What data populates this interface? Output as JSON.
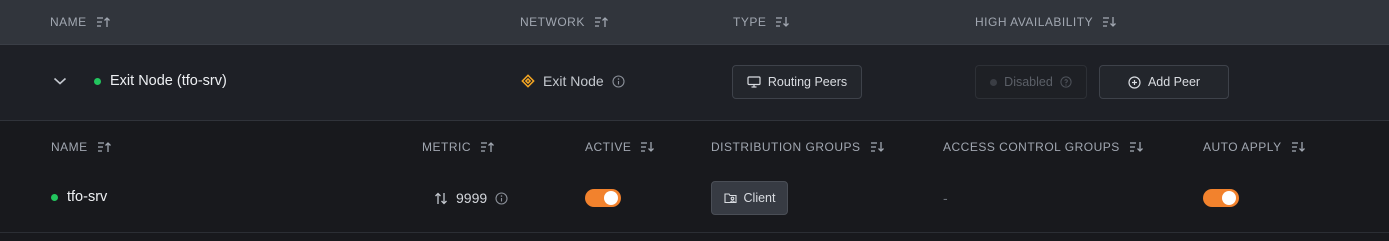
{
  "header": {
    "name": "NAME",
    "network": "NETWORK",
    "type": "TYPE",
    "high_availability": "HIGH AVAILABILITY"
  },
  "route": {
    "name": "Exit Node (tfo-srv)",
    "status_color": "#22c55e",
    "network_label": "Exit Node",
    "type_button": "Routing Peers",
    "ha_label": "Disabled",
    "add_peer_label": "Add Peer"
  },
  "sub_header": {
    "name": "NAME",
    "metric": "METRIC",
    "active": "ACTIVE",
    "distribution_groups": "DISTRIBUTION GROUPS",
    "access_control_groups": "ACCESS CONTROL GROUPS",
    "auto_apply": "AUTO APPLY"
  },
  "peer": {
    "name": "tfo-srv",
    "metric": "9999",
    "active": true,
    "distribution_group": "Client",
    "access_control_groups": "-",
    "auto_apply": true
  },
  "colors": {
    "accent": "#f2822d",
    "online": "#22c55e",
    "exit_node_icon": "#f5a623"
  }
}
